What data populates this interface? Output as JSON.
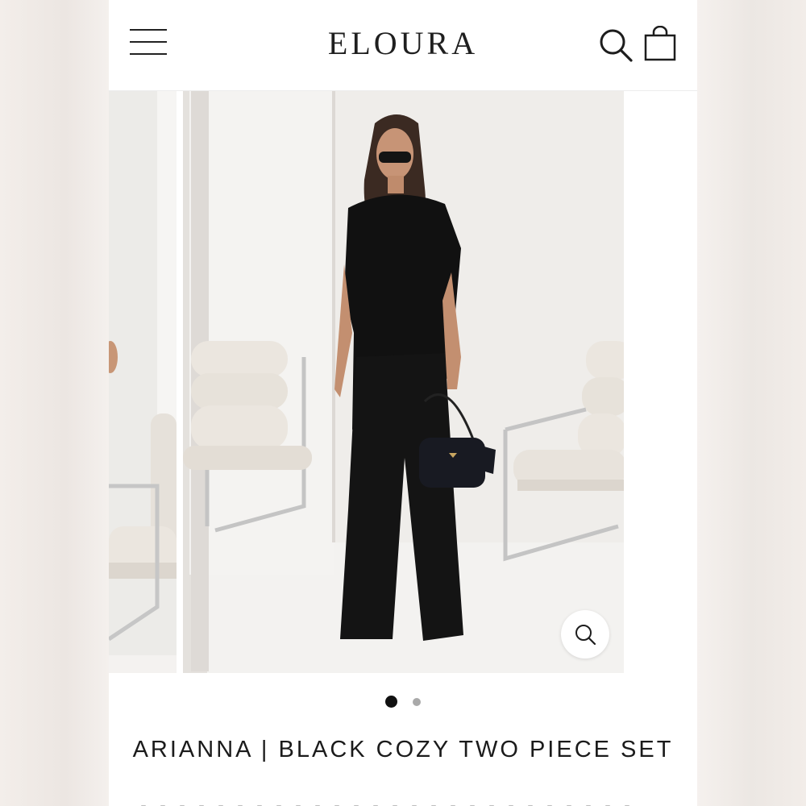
{
  "header": {
    "brand": "ELOURA",
    "menu_icon": "hamburger-menu-icon",
    "search_icon": "search-icon",
    "cart_icon": "shopping-bag-icon"
  },
  "gallery": {
    "zoom_icon": "zoom-magnifier-icon",
    "slide_count": 2,
    "active_slide": 1,
    "image_description": "Model wearing black asymmetric top and wide-leg trousers with black shoulder bag, boucle chairs in background"
  },
  "product": {
    "title": "ARIANNA | BLACK COZY TWO PIECE SET"
  },
  "colors": {
    "accent": "#111111",
    "inactive_dot": "#a9a9a9",
    "background": "#ffffff"
  }
}
